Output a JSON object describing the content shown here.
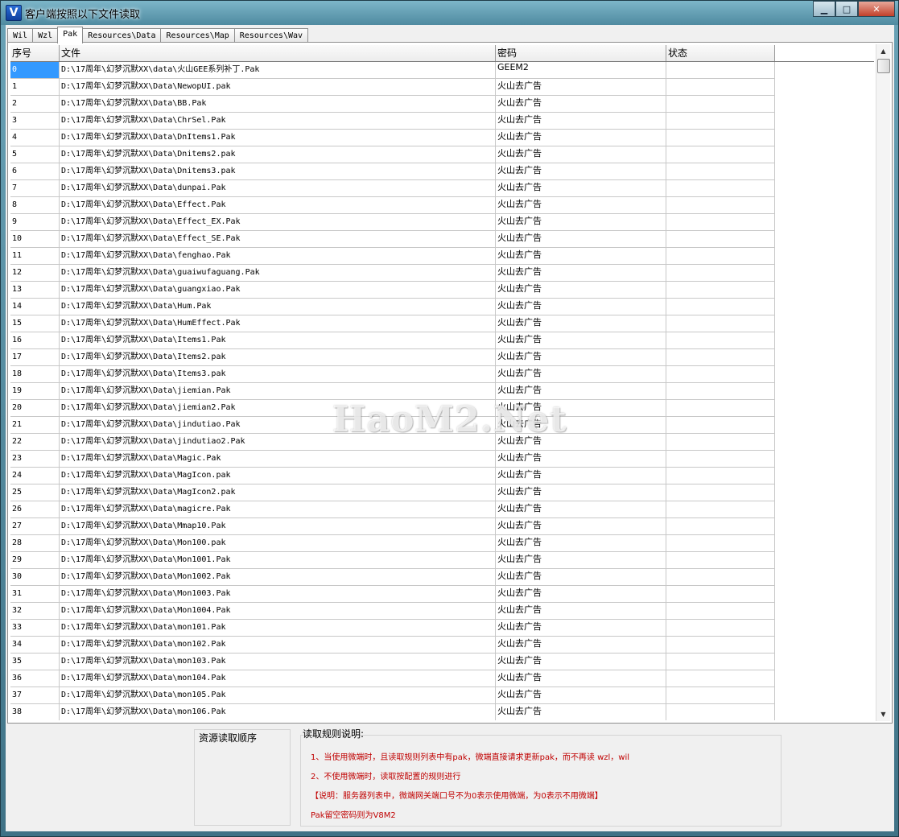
{
  "window": {
    "title": "客户端按照以下文件读取",
    "icon_letter": "V",
    "controls": {
      "minimize": "▁",
      "maximize": "□",
      "close": "✕"
    }
  },
  "tabs": [
    {
      "label": "Wil",
      "active": false
    },
    {
      "label": "Wzl",
      "active": false
    },
    {
      "label": "Pak",
      "active": true
    },
    {
      "label": "Resources\\Data",
      "active": false
    },
    {
      "label": "Resources\\Map",
      "active": false
    },
    {
      "label": "Resources\\Wav",
      "active": false
    }
  ],
  "table": {
    "columns": [
      "序号",
      "文件",
      "密码",
      "状态"
    ],
    "selected_row": 0,
    "rows": [
      [
        "0",
        "D:\\17周年\\幻梦沉默XX\\data\\火山GEE系列补丁.Pak",
        "GEEM2",
        ""
      ],
      [
        "1",
        "D:\\17周年\\幻梦沉默XX\\Data\\NewopUI.pak",
        "火山去广告",
        ""
      ],
      [
        "2",
        "D:\\17周年\\幻梦沉默XX\\Data\\BB.Pak",
        "火山去广告",
        ""
      ],
      [
        "3",
        "D:\\17周年\\幻梦沉默XX\\Data\\ChrSel.Pak",
        "火山去广告",
        ""
      ],
      [
        "4",
        "D:\\17周年\\幻梦沉默XX\\Data\\DnItems1.Pak",
        "火山去广告",
        ""
      ],
      [
        "5",
        "D:\\17周年\\幻梦沉默XX\\Data\\Dnitems2.pak",
        "火山去广告",
        ""
      ],
      [
        "6",
        "D:\\17周年\\幻梦沉默XX\\Data\\Dnitems3.pak",
        "火山去广告",
        ""
      ],
      [
        "7",
        "D:\\17周年\\幻梦沉默XX\\Data\\dunpai.Pak",
        "火山去广告",
        ""
      ],
      [
        "8",
        "D:\\17周年\\幻梦沉默XX\\Data\\Effect.Pak",
        "火山去广告",
        ""
      ],
      [
        "9",
        "D:\\17周年\\幻梦沉默XX\\Data\\Effect_EX.Pak",
        "火山去广告",
        ""
      ],
      [
        "10",
        "D:\\17周年\\幻梦沉默XX\\Data\\Effect_SE.Pak",
        "火山去广告",
        ""
      ],
      [
        "11",
        "D:\\17周年\\幻梦沉默XX\\Data\\fenghao.Pak",
        "火山去广告",
        ""
      ],
      [
        "12",
        "D:\\17周年\\幻梦沉默XX\\Data\\guaiwufaguang.Pak",
        "火山去广告",
        ""
      ],
      [
        "13",
        "D:\\17周年\\幻梦沉默XX\\Data\\guangxiao.Pak",
        "火山去广告",
        ""
      ],
      [
        "14",
        "D:\\17周年\\幻梦沉默XX\\Data\\Hum.Pak",
        "火山去广告",
        ""
      ],
      [
        "15",
        "D:\\17周年\\幻梦沉默XX\\Data\\HumEffect.Pak",
        "火山去广告",
        ""
      ],
      [
        "16",
        "D:\\17周年\\幻梦沉默XX\\Data\\Items1.Pak",
        "火山去广告",
        ""
      ],
      [
        "17",
        "D:\\17周年\\幻梦沉默XX\\Data\\Items2.pak",
        "火山去广告",
        ""
      ],
      [
        "18",
        "D:\\17周年\\幻梦沉默XX\\Data\\Items3.pak",
        "火山去广告",
        ""
      ],
      [
        "19",
        "D:\\17周年\\幻梦沉默XX\\Data\\jiemian.Pak",
        "火山去广告",
        ""
      ],
      [
        "20",
        "D:\\17周年\\幻梦沉默XX\\Data\\jiemian2.Pak",
        "火山去广告",
        ""
      ],
      [
        "21",
        "D:\\17周年\\幻梦沉默XX\\Data\\jindutiao.Pak",
        "火山去广告",
        ""
      ],
      [
        "22",
        "D:\\17周年\\幻梦沉默XX\\Data\\jindutiao2.Pak",
        "火山去广告",
        ""
      ],
      [
        "23",
        "D:\\17周年\\幻梦沉默XX\\Data\\Magic.Pak",
        "火山去广告",
        ""
      ],
      [
        "24",
        "D:\\17周年\\幻梦沉默XX\\Data\\MagIcon.pak",
        "火山去广告",
        ""
      ],
      [
        "25",
        "D:\\17周年\\幻梦沉默XX\\Data\\MagIcon2.pak",
        "火山去广告",
        ""
      ],
      [
        "26",
        "D:\\17周年\\幻梦沉默XX\\Data\\magicre.Pak",
        "火山去广告",
        ""
      ],
      [
        "27",
        "D:\\17周年\\幻梦沉默XX\\Data\\Mmap10.Pak",
        "火山去广告",
        ""
      ],
      [
        "28",
        "D:\\17周年\\幻梦沉默XX\\Data\\Mon100.pak",
        "火山去广告",
        ""
      ],
      [
        "29",
        "D:\\17周年\\幻梦沉默XX\\Data\\Mon1001.Pak",
        "火山去广告",
        ""
      ],
      [
        "30",
        "D:\\17周年\\幻梦沉默XX\\Data\\Mon1002.Pak",
        "火山去广告",
        ""
      ],
      [
        "31",
        "D:\\17周年\\幻梦沉默XX\\Data\\Mon1003.Pak",
        "火山去广告",
        ""
      ],
      [
        "32",
        "D:\\17周年\\幻梦沉默XX\\Data\\Mon1004.Pak",
        "火山去广告",
        ""
      ],
      [
        "33",
        "D:\\17周年\\幻梦沉默XX\\Data\\mon101.Pak",
        "火山去广告",
        ""
      ],
      [
        "34",
        "D:\\17周年\\幻梦沉默XX\\Data\\mon102.Pak",
        "火山去广告",
        ""
      ],
      [
        "35",
        "D:\\17周年\\幻梦沉默XX\\Data\\mon103.Pak",
        "火山去广告",
        ""
      ],
      [
        "36",
        "D:\\17周年\\幻梦沉默XX\\Data\\mon104.Pak",
        "火山去广告",
        ""
      ],
      [
        "37",
        "D:\\17周年\\幻梦沉默XX\\Data\\mon105.Pak",
        "火山去广告",
        ""
      ],
      [
        "38",
        "D:\\17周年\\幻梦沉默XX\\Data\\mon106.Pak",
        "火山去广告",
        ""
      ]
    ]
  },
  "scrollbar": {
    "up_icon": "▲",
    "down_icon": "▼"
  },
  "bottom": {
    "order_title": "资源读取顺序",
    "rules_title": "读取规则说明:",
    "rules": [
      "1、当使用微端时，且读取规则列表中有pak，微端直接请求更新pak，而不再读 wzl，wil",
      "2、不使用微端时，读取按配置的规则进行",
      "【说明：服务器列表中，微端网关端口号不为0表示使用微端，为0表示不用微端】",
      "Pak留空密码则为V8M2"
    ]
  },
  "watermark": "HaoM2.Net",
  "colors": {
    "selection": "#3399ff",
    "rule_text": "#c00000"
  }
}
